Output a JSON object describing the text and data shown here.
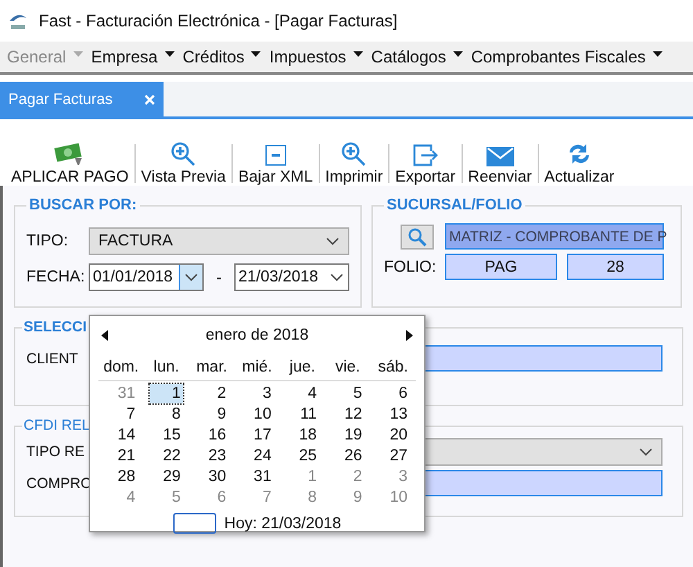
{
  "window": {
    "title": "Fast - Facturación Electrónica - [Pagar Facturas]"
  },
  "menu": [
    {
      "label": "General",
      "disabled": true
    },
    {
      "label": "Empresa",
      "disabled": false
    },
    {
      "label": "Créditos",
      "disabled": false
    },
    {
      "label": "Impuestos",
      "disabled": false
    },
    {
      "label": "Catálogos",
      "disabled": false
    },
    {
      "label": "Comprobantes Fiscales",
      "disabled": false
    }
  ],
  "tabs": [
    {
      "label": "Pagar Facturas",
      "selected": true
    }
  ],
  "toolbar": [
    {
      "label": "APLICAR PAGO",
      "kind": "money"
    },
    {
      "label": "Vista Previa",
      "kind": "zoom"
    },
    {
      "label": "Bajar XML",
      "kind": "xml"
    },
    {
      "label": "Imprimir",
      "kind": "zoom"
    },
    {
      "label": "Exportar",
      "kind": "export"
    },
    {
      "label": "Reenviar",
      "kind": "mail"
    },
    {
      "label": "Actualizar",
      "kind": "refresh"
    }
  ],
  "search": {
    "title": "BUSCAR POR:",
    "tipo_label": "TIPO:",
    "tipo_value": "FACTURA",
    "fecha_label": "FECHA:",
    "date_from": {
      "value": "01/01/2018",
      "open": true
    },
    "separator": "-",
    "date_to": {
      "value": "21/03/2018",
      "open": false
    }
  },
  "branch": {
    "title": "SUCURSAL/FOLIO",
    "value": "MATRIZ - COMPROBANTE DE P",
    "folio_label": "FOLIO:",
    "series": "PAG",
    "number": "28"
  },
  "selection": {
    "title": "SELECCI",
    "client_label": "CLIENT"
  },
  "cfdi": {
    "title": "CFDI REL",
    "type_label": "TIPO RE",
    "voucher_label": "COMPRO"
  },
  "calendar": {
    "month": "enero de 2018",
    "weekdays": [
      "dom.",
      "lun.",
      "mar.",
      "mié.",
      "jue.",
      "vie.",
      "sáb."
    ],
    "weeks": [
      [
        {
          "day": "31",
          "other": true,
          "selected": false
        },
        {
          "day": "1",
          "other": false,
          "selected": true
        },
        {
          "day": "2",
          "other": false,
          "selected": false
        },
        {
          "day": "3",
          "other": false,
          "selected": false
        },
        {
          "day": "4",
          "other": false,
          "selected": false
        },
        {
          "day": "5",
          "other": false,
          "selected": false
        },
        {
          "day": "6",
          "other": false,
          "selected": false
        }
      ],
      [
        {
          "day": "7",
          "other": false,
          "selected": false
        },
        {
          "day": "8",
          "other": false,
          "selected": false
        },
        {
          "day": "9",
          "other": false,
          "selected": false
        },
        {
          "day": "10",
          "other": false,
          "selected": false
        },
        {
          "day": "11",
          "other": false,
          "selected": false
        },
        {
          "day": "12",
          "other": false,
          "selected": false
        },
        {
          "day": "13",
          "other": false,
          "selected": false
        }
      ],
      [
        {
          "day": "14",
          "other": false,
          "selected": false
        },
        {
          "day": "15",
          "other": false,
          "selected": false
        },
        {
          "day": "16",
          "other": false,
          "selected": false
        },
        {
          "day": "17",
          "other": false,
          "selected": false
        },
        {
          "day": "18",
          "other": false,
          "selected": false
        },
        {
          "day": "19",
          "other": false,
          "selected": false
        },
        {
          "day": "20",
          "other": false,
          "selected": false
        }
      ],
      [
        {
          "day": "21",
          "other": false,
          "selected": false
        },
        {
          "day": "22",
          "other": false,
          "selected": false
        },
        {
          "day": "23",
          "other": false,
          "selected": false
        },
        {
          "day": "24",
          "other": false,
          "selected": false
        },
        {
          "day": "25",
          "other": false,
          "selected": false
        },
        {
          "day": "26",
          "other": false,
          "selected": false
        },
        {
          "day": "27",
          "other": false,
          "selected": false
        }
      ],
      [
        {
          "day": "28",
          "other": false,
          "selected": false
        },
        {
          "day": "29",
          "other": false,
          "selected": false
        },
        {
          "day": "30",
          "other": false,
          "selected": false
        },
        {
          "day": "31",
          "other": false,
          "selected": false
        },
        {
          "day": "1",
          "other": true,
          "selected": false
        },
        {
          "day": "2",
          "other": true,
          "selected": false
        },
        {
          "day": "3",
          "other": true,
          "selected": false
        }
      ],
      [
        {
          "day": "4",
          "other": true,
          "selected": false
        },
        {
          "day": "5",
          "other": true,
          "selected": false
        },
        {
          "day": "6",
          "other": true,
          "selected": false
        },
        {
          "day": "7",
          "other": true,
          "selected": false
        },
        {
          "day": "8",
          "other": true,
          "selected": false
        },
        {
          "day": "9",
          "other": true,
          "selected": false
        },
        {
          "day": "10",
          "other": true,
          "selected": false
        }
      ]
    ],
    "today": "Hoy: 21/03/2018"
  }
}
